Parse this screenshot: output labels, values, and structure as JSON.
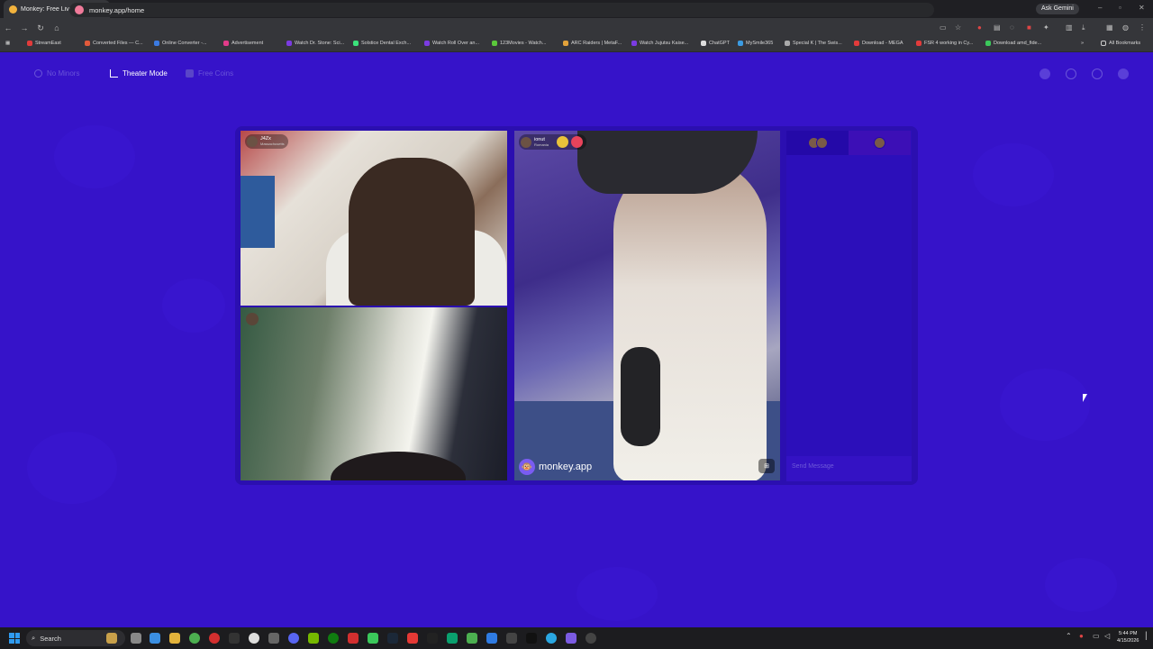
{
  "browser": {
    "tab_title": "Monkey: Free Live Video Ch",
    "tab_close": "×",
    "new_tab": "+",
    "ask_gemini": "Ask Gemini",
    "url": "monkey.app/home",
    "all_bookmarks": "All Bookmarks",
    "bookmarks": [
      {
        "label": "StreamEast",
        "color": "#e23b3b"
      },
      {
        "label": "Converted Files — C...",
        "color": "#e25a3b"
      },
      {
        "label": "Online Converter -...",
        "color": "#3b7be2"
      },
      {
        "label": "Advertisement",
        "color": "#e23b8a"
      },
      {
        "label": "Watch Dr. Stone: Sci...",
        "color": "#7b3be2"
      },
      {
        "label": "Solstice Dental Exch...",
        "color": "#3be27b"
      },
      {
        "label": "Watch Roll Over an...",
        "color": "#7b3be2"
      },
      {
        "label": "123Movies - Watch...",
        "color": "#5bc83b"
      },
      {
        "label": "ARC Raiders | MetaF...",
        "color": "#e2a23b"
      },
      {
        "label": "Watch Jujutsu Kaise...",
        "color": "#7b3be2"
      },
      {
        "label": "ChatGPT",
        "color": "#dddddd"
      },
      {
        "label": "MySmile365",
        "color": "#3b9be2"
      },
      {
        "label": "Special K | The Swis...",
        "color": "#aaaaaa"
      },
      {
        "label": "Download - MEGA",
        "color": "#e23b3b"
      },
      {
        "label": "FSR 4 working in Cy...",
        "color": "#e23b3b"
      },
      {
        "label": "Download amd_fide...",
        "color": "#3bc85b"
      }
    ]
  },
  "monkey": {
    "top_controls": {
      "no_minors": "No Minors",
      "theater_mode": "Theater Mode",
      "free_coins": "Free Coins"
    },
    "videos": [
      {
        "user": "J4Zx",
        "country": "Massachusetts"
      },
      {
        "user": "",
        "country": ""
      },
      {
        "user": "ionut",
        "country": "Romania"
      }
    ],
    "watermark": "monkey.app",
    "chat": {
      "placeholder": "Send Message"
    }
  },
  "taskbar": {
    "search": "Search",
    "time": "5:44 PM",
    "date": "4/15/2026"
  },
  "colors": {
    "page_bg": "#3613c9",
    "stage_bg": "#2b0fb0",
    "chat_bg": "#2c0fba"
  }
}
